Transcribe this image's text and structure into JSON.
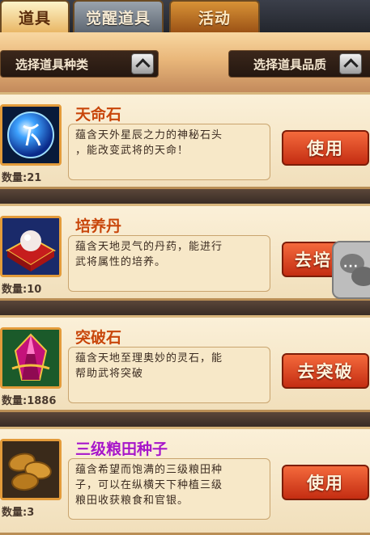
{
  "tabs": [
    {
      "label": "道具",
      "active": true
    },
    {
      "label": "觉醒道具",
      "active": false
    },
    {
      "label": "活动",
      "active": false
    }
  ],
  "filters": {
    "type_label": "选择道具种类",
    "quality_label": "选择道具品质"
  },
  "items": [
    {
      "name": "天命石",
      "name_color": "#c8460a",
      "desc_line1": "蕴含天外星辰之力的神秘石头",
      "desc_line2": "，能改变武将的天命！",
      "desc_line3": "",
      "qty": "数量:21",
      "action": "使用",
      "icon": "blue-orb-icon"
    },
    {
      "name": "培养丹",
      "name_color": "#c8460a",
      "desc_line1": "蕴含天地灵气的丹药，能进行",
      "desc_line2": "武将属性的培养。",
      "desc_line3": "",
      "qty": "数量:10",
      "action": "去培",
      "icon": "pearl-on-cushion-icon"
    },
    {
      "name": "突破石",
      "name_color": "#c8460a",
      "desc_line1": "蕴含天地至理奥妙的灵石，能",
      "desc_line2": "帮助武将突破",
      "desc_line3": "",
      "qty": "数量:1886",
      "action": "去突破",
      "icon": "red-crystal-icon"
    },
    {
      "name": "三级粮田种子",
      "name_color": "#a716c9",
      "desc_line1": "蕴含希望而饱满的三级粮田种",
      "desc_line2": "子，可以在纵横天下种植三级",
      "desc_line3": "粮田收获粮食和官银。",
      "qty": "数量:3",
      "action": "使用",
      "icon": "seeds-icon"
    }
  ],
  "floating": {
    "icon": "chat-bubbles-icon"
  }
}
